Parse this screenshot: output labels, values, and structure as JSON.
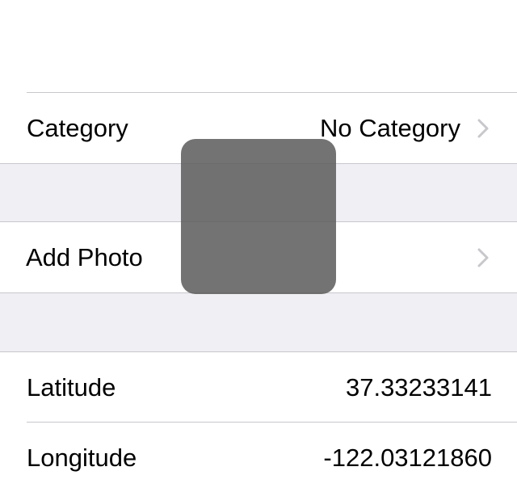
{
  "rows": {
    "category": {
      "label": "Category",
      "value": "No Category"
    },
    "add_photo": {
      "label": "Add Photo"
    },
    "latitude": {
      "label": "Latitude",
      "value": "37.33233141"
    },
    "longitude": {
      "label": "Longitude",
      "value": "-122.03121860"
    }
  },
  "icons": {
    "disclosure": "chevron-right-icon"
  },
  "colors": {
    "group_background": "#efeff4",
    "separator": "#c8c7cc",
    "chevron": "#c7c7cc",
    "hud_overlay": "#5a5a5a"
  }
}
